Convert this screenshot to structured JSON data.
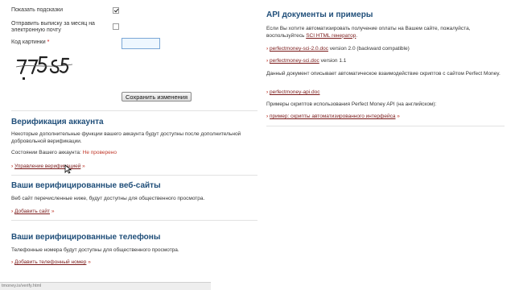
{
  "settings": {
    "show_hints_label": "Показать подсказки",
    "show_hints_checked": true,
    "monthly_statement_label_1": "Отправить выписку за месяц на",
    "monthly_statement_label_2": "электронную почту",
    "monthly_statement_checked": false,
    "captcha_label": "Код картинки",
    "captcha_required_mark": "*",
    "captcha_value": "",
    "save_button": "Сохранить изменения"
  },
  "verification": {
    "title": "Верификация аккаунта",
    "description": "Некоторые дополнительные функции вашего аккаунта будут доступны после дополнительной добровольной верификации.",
    "status_label": "Состоянии Вашего аккаунта:",
    "status_value": "Не проверено",
    "manage_link": "Управление верификацией"
  },
  "websites": {
    "title": "Ваши верифицированные веб-сайты",
    "description": "Веб сайт перечисленные ниже, будут доступны для общественного просмотра.",
    "add_link": "Добавить сайт"
  },
  "phones": {
    "title": "Ваши верифицированные телефоны",
    "description": "Телефонные номера будут доступны для общественного просмотра.",
    "add_link": "Добавить телефонный номер"
  },
  "api": {
    "title": "API документы и примеры",
    "intro": "Если Вы хотите автоматизировать получение оплаты на Вашем сайте, пожалуйста, воспользуйтесь",
    "sci_link": "SCI HTML генератор",
    "sci_link_after": ".",
    "doc1_link": "perfectmoney-sci-2.0.doc",
    "doc1_suffix": "version 2.0 (backward compatible)",
    "doc2_link": "perfectmoney-sci.doc",
    "doc2_suffix": "version 1.1",
    "api_desc": "Данный документ описывает автоматическое взаимодействие скриптов с сайтом Perfect Money.",
    "doc3_link": "perfectmoney-api.doc",
    "examples_text": "Примеры скриптов использования Perfect Money API (на английском):",
    "examples_link": "пример: скрипты автоматизированного интерфейса"
  },
  "status_bar": {
    "url": "tmoney.is/verify.html"
  },
  "bullet": "›",
  "arrow": "»"
}
